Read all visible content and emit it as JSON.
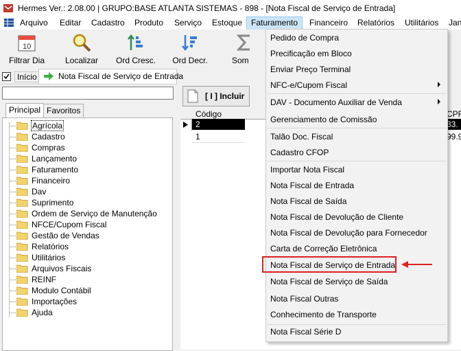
{
  "window": {
    "title": "Hermes Ver.: 2.08.00 | GRUPO:BASE ATLANTA SISTEMAS - 898 - [Nota Fiscal de Serviço de Entrada]"
  },
  "menubar": {
    "items": [
      "Arquivo",
      "Editar",
      "Cadastro",
      "Produto",
      "Serviço",
      "Estoque",
      "Faturamento",
      "Financeiro",
      "Relatórios",
      "Utilitários",
      "Jan"
    ]
  },
  "toolbar": {
    "buttons": [
      "Filtrar Dia",
      "Localizar",
      "Ord Cresc.",
      "Ord Decr.",
      "Som"
    ]
  },
  "tabs": {
    "home": "Início",
    "active": "Nota Fiscal de Serviço de Entrada"
  },
  "left_panel": {
    "search_value": "",
    "tabs": [
      "Principal",
      "Favoritos"
    ],
    "tree": [
      "Agrícola",
      "Cadastro",
      "Compras",
      "Lançamento",
      "Faturamento",
      "Financeiro",
      "Dav",
      "Suprimento",
      "Ordem de Serviço de Manutenção",
      "NFCE/Cupom Fiscal",
      "Gestão de Vendas",
      "Relatórios",
      "Utilitários",
      "Arquivos Fiscais",
      "REINF",
      "Modulo Contábil",
      "Importações",
      "Ajuda"
    ]
  },
  "content": {
    "include_button": "[ I ] Incluir",
    "grid": {
      "col_codigo": "Código",
      "col_cpf": "CPF",
      "rows": [
        {
          "codigo": "2",
          "cpf": "33."
        },
        {
          "codigo": "1",
          "cpf": "99.9"
        }
      ]
    }
  },
  "faturamento_menu": {
    "items": [
      {
        "label": "Pedido de Compra",
        "submenu": false
      },
      {
        "label": "Precificação em Bloco",
        "submenu": false
      },
      {
        "label": "Enviar Preço Terminal",
        "submenu": false
      },
      {
        "label": "NFC-e/Cupom Fiscal",
        "submenu": true
      },
      {
        "label": "DAV - Documento Auxiliar de Venda",
        "submenu": true
      },
      {
        "label": "Gerenciamento de Comissão",
        "submenu": false
      },
      {
        "label": "Talão Doc. Fiscal",
        "submenu": false
      },
      {
        "label": "Cadastro CFOP",
        "submenu": false
      },
      {
        "label": "Importar Nota Fiscal",
        "submenu": false
      },
      {
        "label": "Nota Fiscal de Entrada",
        "submenu": false
      },
      {
        "label": "Nota Fiscal de Saída",
        "submenu": false
      },
      {
        "label": "Nota Fiscal de Devolução de Cliente",
        "submenu": false
      },
      {
        "label": "Nota Fiscal de Devolução para Fornecedor",
        "submenu": false
      },
      {
        "label": "Carta de Correção Eletrônica",
        "submenu": false
      },
      {
        "label": "Nota Fiscal de Serviço de Entrada",
        "submenu": false,
        "highlighted": true
      },
      {
        "label": "Nota Fiscal de Serviço de Saída",
        "submenu": false
      },
      {
        "label": "Nota Fiscal Outras",
        "submenu": false
      },
      {
        "label": "Conhecimento de Transporte",
        "submenu": false
      },
      {
        "label": "Nota Fiscal Série D",
        "submenu": false
      }
    ]
  },
  "colors": {
    "highlight_annotation": "#e02020",
    "menu_active_bg": "#cce4f7",
    "folder": "#f3d36b"
  },
  "icons": [
    "app-icon",
    "filter-day-icon",
    "search-icon",
    "sort-asc-icon",
    "sort-desc-icon",
    "sum-icon",
    "folder-icon",
    "document-icon",
    "arrow-right-icon",
    "grid-icon"
  ]
}
